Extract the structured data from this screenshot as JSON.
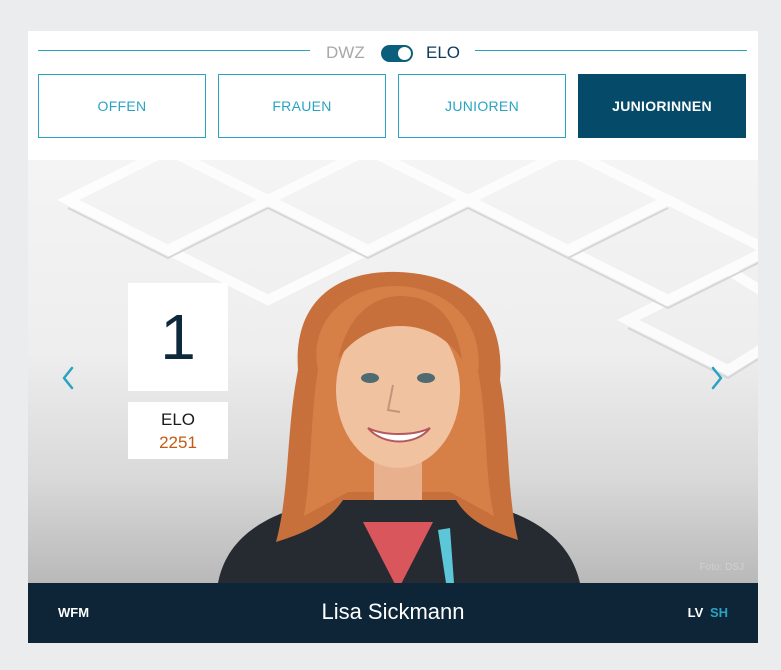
{
  "toggle": {
    "left_label": "DWZ",
    "right_label": "ELO",
    "state": "ELO"
  },
  "tabs": [
    {
      "label": "OFFEN",
      "active": false
    },
    {
      "label": "FRAUEN",
      "active": false
    },
    {
      "label": "JUNIOREN",
      "active": false
    },
    {
      "label": "JUNIORINNEN",
      "active": true
    }
  ],
  "slide": {
    "rank": "1",
    "rating_label": "ELO",
    "rating_value": "2251",
    "photo_credit": "Foto: DSJ"
  },
  "player": {
    "title": "WFM",
    "name": "Lisa Sickmann",
    "association_prefix": "LV",
    "association_code": "SH"
  },
  "colors": {
    "accent": "#2aa3c3",
    "active_tab": "#064a6a",
    "footer": "#0d2536",
    "rating_value": "#c25a12"
  },
  "icons": {
    "prev": "chevron-left-icon",
    "next": "chevron-right-icon"
  }
}
